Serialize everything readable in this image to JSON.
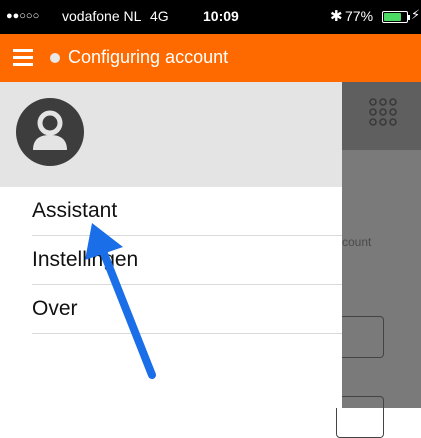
{
  "status_bar": {
    "signal_dots": "●●○○○",
    "carrier": "vodafone NL",
    "network": "4G",
    "time": "10:09",
    "bluetooth_glyph": "✱",
    "battery_percent": "77%",
    "battery_level": 0.77,
    "charging_glyph": "⚡"
  },
  "header": {
    "title": "Configuring account",
    "accent_color": "#ff6a00"
  },
  "drawer": {
    "menu_items": [
      {
        "label": "Assistant"
      },
      {
        "label": "Instellingen"
      },
      {
        "label": "Over"
      }
    ]
  },
  "background": {
    "partial_text": "count"
  },
  "icons": [
    "menu-icon",
    "status-dot-icon",
    "avatar-icon",
    "dialpad-icon",
    "bluetooth-icon",
    "battery-icon"
  ]
}
